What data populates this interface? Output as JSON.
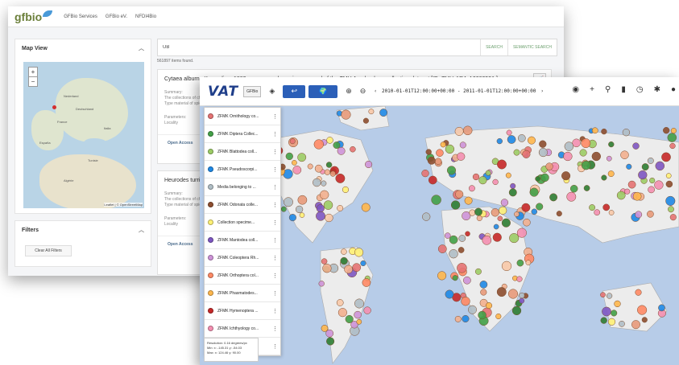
{
  "gfbio": {
    "logo": "gfbio",
    "nav": [
      "GFBio Services",
      "GFBio eV.",
      "NFDI4Bio"
    ],
    "map_view": {
      "title": "Map View",
      "attribution": "Leaflet | © OpenStreetMap",
      "cities": [
        "Deutschland",
        "España",
        "Algérie",
        "Tunisie",
        "Italia",
        "France",
        "Nederland"
      ]
    },
    "filters": {
      "title": "Filters",
      "clear_label": "Clear All Filters"
    },
    "search": {
      "value": "UB",
      "search_label": "SEARCH",
      "semantic_label": "SEMANTIC SEARCH"
    },
    "results_count": "561897 items found.",
    "results": [
      {
        "title": "Cytaea alburna Keyserling, 1882, a preserved specimen record of the ZMH Arachnology collection dataset [ID: ZMH-ARA-A0003591 ]",
        "summary_label": "Summary:",
        "summary_lines": [
          "The collections of chelic",
          "Type material of spider"
        ],
        "params_label": "Parameters:",
        "params_lines": [
          "Locality"
        ],
        "open_access": "Open Access",
        "extra": "Li"
      },
      {
        "title": "Heurodes turrita Ke",
        "summary_label": "Summary:",
        "summary_lines": [
          "The collections of chelic",
          "Type material of spider"
        ],
        "params_label": "Parameters:",
        "params_lines": [
          "Locality"
        ],
        "open_access": "Open Access",
        "extra": "Li"
      }
    ]
  },
  "vat": {
    "logo": "VAT",
    "chip_label": "GFBio",
    "time_range": "2010-01-01T12:00:00+00:00 - 2011-01-01T12:00:00+00:00",
    "layers": [
      {
        "name": "ZFMK Ornithology co...",
        "color": "#e57373"
      },
      {
        "name": "ZFMK Diptera Collec...",
        "color": "#43a047"
      },
      {
        "name": "ZFMK Blattodea coll...",
        "color": "#9ccc65"
      },
      {
        "name": "ZFMK Pseudoscorpi...",
        "color": "#1e88e5"
      },
      {
        "name": "Media belonging to ...",
        "color": "#b0bec5"
      },
      {
        "name": "ZFMK Odonata colle...",
        "color": "#8d4e2f"
      },
      {
        "name": "Collection specime...",
        "color": "#fff176"
      },
      {
        "name": "ZFMK Mantodea coll...",
        "color": "#7e57c2"
      },
      {
        "name": "ZFMK Coleoptera Rh...",
        "color": "#ce93d8"
      },
      {
        "name": "ZFMK Orthoptera col...",
        "color": "#ff8a65"
      },
      {
        "name": "ZFMK Phasmatodes...",
        "color": "#ffb74d"
      },
      {
        "name": "ZFMK Hymenoptera ...",
        "color": "#c62828"
      },
      {
        "name": "ZFMK Ichthyology co...",
        "color": "#f48fb1"
      },
      {
        "name": "ZFMK Heteroptera c...",
        "color": "#2e7d32"
      }
    ],
    "resolution": {
      "line1": "Resolution: 0.16 degrees/px",
      "line2": "Min:  x: -145.31   y: -54.03",
      "line3": "Max:  x: 124.46   y: 90.00"
    }
  }
}
